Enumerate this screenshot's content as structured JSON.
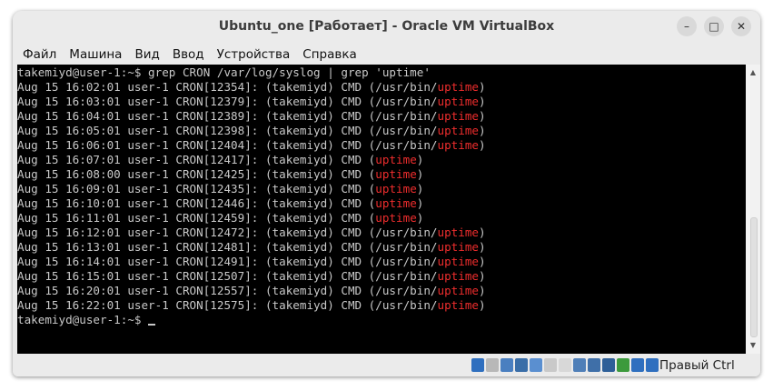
{
  "window": {
    "title": "Ubuntu_one [Работает] - Oracle VM VirtualBox",
    "minimize_glyph": "–",
    "maximize_glyph": "□",
    "close_glyph": "✕"
  },
  "menu": [
    "Файл",
    "Машина",
    "Вид",
    "Ввод",
    "Устройства",
    "Справка"
  ],
  "terminal": {
    "command_line": "takemiyd@user-1:~$ grep CRON /var/log/syslog | grep 'uptime'",
    "highlight_color": "#ee2d2d",
    "lines": [
      {
        "prefix": "Aug 15 16:02:01 user-1 CRON[12354]: (takemiyd) CMD (/usr/bin/",
        "match": "uptime",
        "suffix": ")"
      },
      {
        "prefix": "Aug 15 16:03:01 user-1 CRON[12379]: (takemiyd) CMD (/usr/bin/",
        "match": "uptime",
        "suffix": ")"
      },
      {
        "prefix": "Aug 15 16:04:01 user-1 CRON[12389]: (takemiyd) CMD (/usr/bin/",
        "match": "uptime",
        "suffix": ")"
      },
      {
        "prefix": "Aug 15 16:05:01 user-1 CRON[12398]: (takemiyd) CMD (/usr/bin/",
        "match": "uptime",
        "suffix": ")"
      },
      {
        "prefix": "Aug 15 16:06:01 user-1 CRON[12404]: (takemiyd) CMD (/usr/bin/",
        "match": "uptime",
        "suffix": ")"
      },
      {
        "prefix": "Aug 15 16:07:01 user-1 CRON[12417]: (takemiyd) CMD (",
        "match": "uptime",
        "suffix": ")"
      },
      {
        "prefix": "Aug 15 16:08:00 user-1 CRON[12425]: (takemiyd) CMD (",
        "match": "uptime",
        "suffix": ")"
      },
      {
        "prefix": "Aug 15 16:09:01 user-1 CRON[12435]: (takemiyd) CMD (",
        "match": "uptime",
        "suffix": ")"
      },
      {
        "prefix": "Aug 15 16:10:01 user-1 CRON[12446]: (takemiyd) CMD (",
        "match": "uptime",
        "suffix": ")"
      },
      {
        "prefix": "Aug 15 16:11:01 user-1 CRON[12459]: (takemiyd) CMD (",
        "match": "uptime",
        "suffix": ")"
      },
      {
        "prefix": "Aug 15 16:12:01 user-1 CRON[12472]: (takemiyd) CMD (/usr/bin/",
        "match": "uptime",
        "suffix": ")"
      },
      {
        "prefix": "Aug 15 16:13:01 user-1 CRON[12481]: (takemiyd) CMD (/usr/bin/",
        "match": "uptime",
        "suffix": ")"
      },
      {
        "prefix": "Aug 15 16:14:01 user-1 CRON[12491]: (takemiyd) CMD (/usr/bin/",
        "match": "uptime",
        "suffix": ")"
      },
      {
        "prefix": "Aug 15 16:15:01 user-1 CRON[12507]: (takemiyd) CMD (/usr/bin/",
        "match": "uptime",
        "suffix": ")"
      },
      {
        "prefix": "Aug 15 16:20:01 user-1 CRON[12557]: (takemiyd) CMD (/usr/bin/",
        "match": "uptime",
        "suffix": ")"
      },
      {
        "prefix": "Aug 15 16:22:01 user-1 CRON[12575]: (takemiyd) CMD (/usr/bin/",
        "match": "uptime",
        "suffix": ")"
      }
    ],
    "prompt": "takemiyd@user-1:~$ "
  },
  "statusbar": {
    "icons": [
      {
        "name": "hard-disk-icon",
        "color": "#2f6fbf"
      },
      {
        "name": "optical-drive-icon",
        "color": "#b8b8b8"
      },
      {
        "name": "audio-icon",
        "color": "#4a7fc0"
      },
      {
        "name": "network-icon",
        "color": "#3a6ea8"
      },
      {
        "name": "usb-icon",
        "color": "#5a8fd0"
      },
      {
        "name": "shared-folders-icon",
        "color": "#c9c9c9"
      },
      {
        "name": "display-icon",
        "color": "#d8d8d8"
      },
      {
        "name": "video-capture-icon",
        "color": "#4f7fb8"
      },
      {
        "name": "recording-icon",
        "color": "#3f6fa8"
      },
      {
        "name": "virtualization-icon",
        "color": "#2e5f98"
      },
      {
        "name": "guest-additions-icon",
        "color": "#3c9a3c"
      },
      {
        "name": "mouse-integration-icon",
        "color": "#2f6fbf"
      },
      {
        "name": "keyboard-capture-icon",
        "color": "#2f6fbf"
      }
    ],
    "host_key": "Правый Ctrl"
  }
}
